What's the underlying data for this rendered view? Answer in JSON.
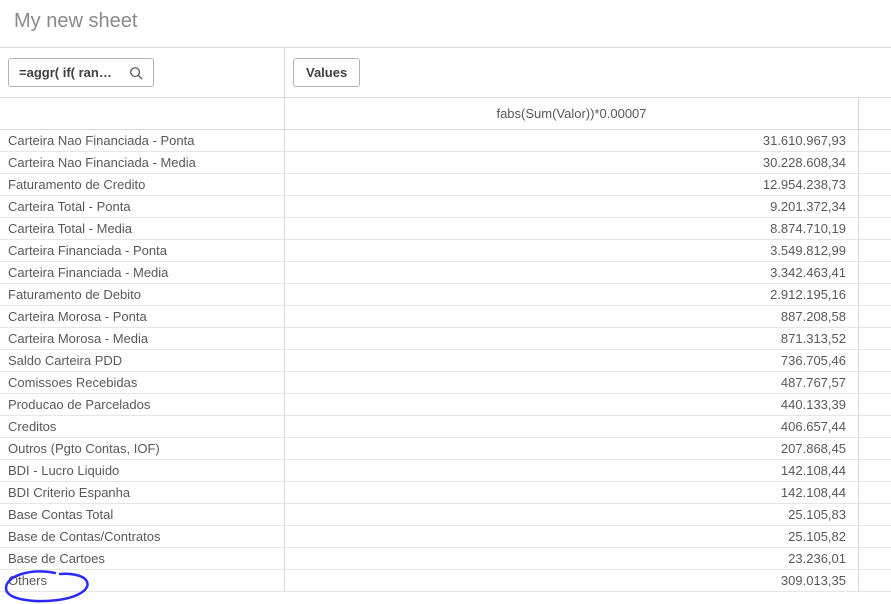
{
  "sheet_title": "My new sheet",
  "dim_selector_text": "=aggr( if( rank(s...",
  "values_button_label": "Values",
  "measure_header": "fabs(Sum(Valor))*0.00007",
  "rows": [
    {
      "label": "Carteira Nao Financiada - Ponta",
      "value": "31.610.967,93"
    },
    {
      "label": "Carteira Nao Financiada - Media",
      "value": "30.228.608,34"
    },
    {
      "label": "Faturamento de Credito",
      "value": "12.954.238,73"
    },
    {
      "label": "Carteira Total - Ponta",
      "value": "9.201.372,34"
    },
    {
      "label": "Carteira Total - Media",
      "value": "8.874.710,19"
    },
    {
      "label": "Carteira Financiada - Ponta",
      "value": "3.549.812,99"
    },
    {
      "label": "Carteira Financiada - Media",
      "value": "3.342.463,41"
    },
    {
      "label": "Faturamento de Debito",
      "value": "2.912.195,16"
    },
    {
      "label": "Carteira Morosa - Ponta",
      "value": "887.208,58"
    },
    {
      "label": "Carteira Morosa - Media",
      "value": "871.313,52"
    },
    {
      "label": "Saldo Carteira PDD",
      "value": "736.705,46"
    },
    {
      "label": "Comissoes Recebidas",
      "value": "487.767,57"
    },
    {
      "label": "Producao de Parcelados",
      "value": "440.133,39"
    },
    {
      "label": "Creditos",
      "value": "406.657,44"
    },
    {
      "label": "Outros (Pgto Contas, IOF)",
      "value": "207.868,45"
    },
    {
      "label": "BDI - Lucro Liquido",
      "value": "142.108,44"
    },
    {
      "label": "BDI Criterio Espanha",
      "value": "142.108,44"
    },
    {
      "label": "Base Contas Total",
      "value": "25.105,83"
    },
    {
      "label": "Base de Contas/Contratos",
      "value": "25.105,82"
    },
    {
      "label": "Base de Cartoes",
      "value": "23.236,01"
    },
    {
      "label": "Others",
      "value": "309.013,35"
    }
  ]
}
